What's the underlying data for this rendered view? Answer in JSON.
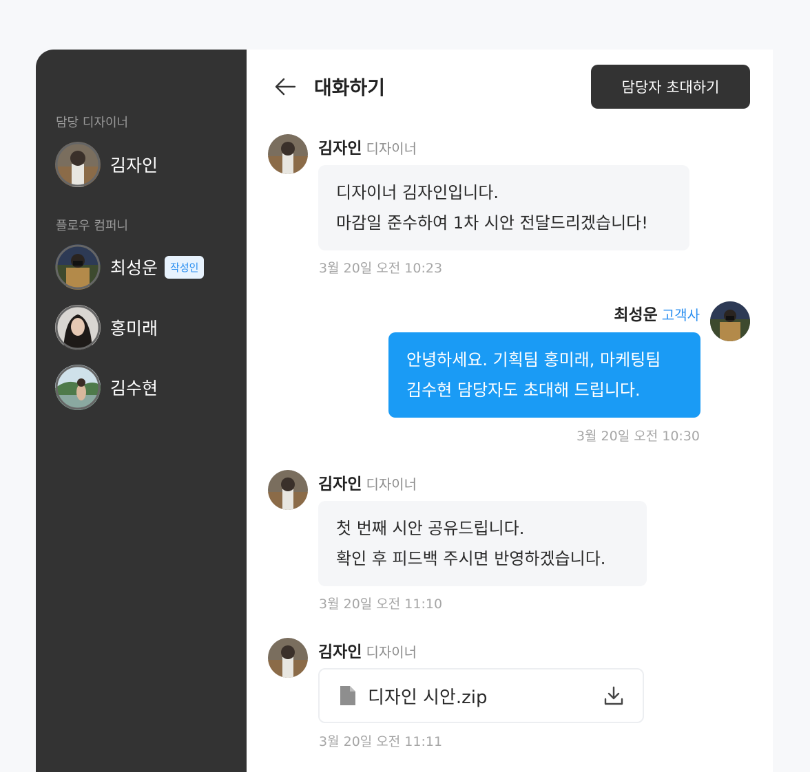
{
  "sidebar": {
    "designer_heading": "담당 디자이너",
    "designer": {
      "name": "김자인"
    },
    "company_heading": "플로우 컴퍼니",
    "members": [
      {
        "name": "최성운",
        "badge": "작성인"
      },
      {
        "name": "홍미래"
      },
      {
        "name": "김수현"
      }
    ]
  },
  "header": {
    "title": "대화하기",
    "invite_label": "담당자 초대하기"
  },
  "messages": [
    {
      "sender": "김자인",
      "role": "디자이너",
      "lines": [
        "디자이너 김자인입니다.",
        "마감일 준수하여 1차 시안 전달드리겠습니다!"
      ],
      "time": "3월 20일 오전 10:23"
    },
    {
      "sender": "최성운",
      "role": "고객사",
      "lines": [
        "안녕하세요. 기획팀 홍미래, 마케팅팀",
        "김수현 담당자도 초대해 드립니다."
      ],
      "time": "3월 20일 오전 10:30"
    },
    {
      "sender": "김자인",
      "role": "디자이너",
      "lines": [
        "첫 번째 시안 공유드립니다.",
        "확인 후 피드백 주시면 반영하겠습니다."
      ],
      "time": "3월 20일 오전 11:10"
    },
    {
      "sender": "김자인",
      "role": "디자이너",
      "file_name": "디자인 시안.zip",
      "time": "3월 20일 오전 11:11"
    }
  ],
  "icons": {
    "back": "arrow-left-icon",
    "file": "file-icon",
    "download": "download-icon"
  },
  "colors": {
    "sidebar_bg": "#333333",
    "mine_bubble": "#1a9bf5",
    "other_bubble": "#f5f6f8",
    "client_role": "#2b8ff0",
    "badge_bg": "#e8f3fe"
  }
}
